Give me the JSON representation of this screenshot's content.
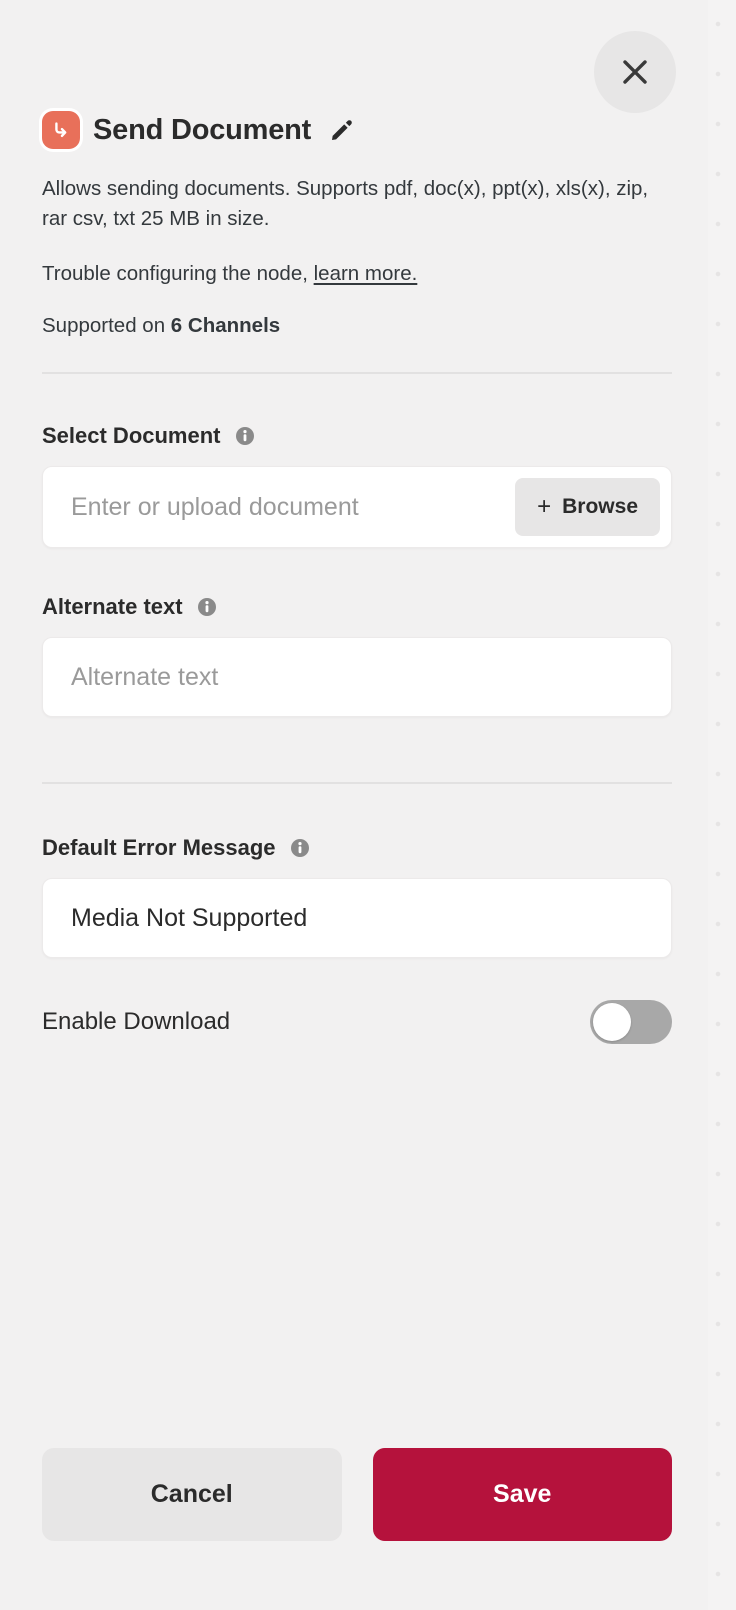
{
  "dialog": {
    "close_label": "Close",
    "icon_name": "send-node-icon",
    "title": "Send Document",
    "edit_label": "Edit title",
    "description": "Allows sending documents. Supports pdf, doc(x), ppt(x), xls(x), zip, rar csv, txt 25 MB in size.",
    "trouble_text": "Trouble configuring the node, ",
    "trouble_link": "learn more.",
    "supported_prefix": "Supported on ",
    "supported_count": "6 Channels"
  },
  "fields": {
    "select_document": {
      "label": "Select Document",
      "value": "",
      "placeholder": "Enter or upload document",
      "browse_label": "Browse",
      "browse_plus": "+"
    },
    "alternate_text": {
      "label": "Alternate text",
      "value": "",
      "placeholder": "Alternate text"
    },
    "error_message": {
      "label": "Default Error Message",
      "value": "Media Not Supported",
      "placeholder": "Media Not Supported"
    },
    "enable_download": {
      "label": "Enable Download",
      "state": "off"
    }
  },
  "footer": {
    "cancel_label": "Cancel",
    "save_label": "Save"
  },
  "colors": {
    "background": "#f2f1f1",
    "panel": "#f2f1f1",
    "node_icon": "#e8705a",
    "save": "#b5123c",
    "cancel": "#e7e6e6",
    "toggle_off": "#a8a8a8",
    "divider": "#e2e1e1",
    "text": "#2b2b2b",
    "placeholder": "#9a9a9a"
  }
}
